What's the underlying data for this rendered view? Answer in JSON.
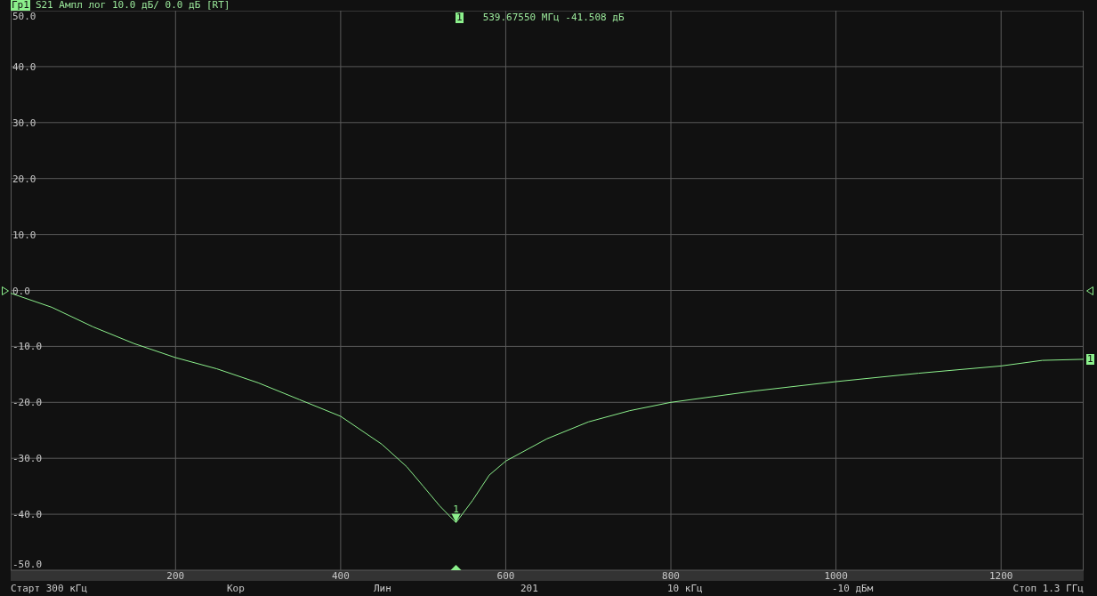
{
  "header": {
    "trace_badge": "Гр1",
    "trace_info": "S21 Ампл лог 10.0 дБ/ 0.0 дБ [RT]"
  },
  "marker_readout": {
    "badge": "1",
    "value": "539.67550 МГц -41.508 дБ"
  },
  "trace_end_badge": "1",
  "chart": {
    "chart_data": {
      "type": "line",
      "grid": true,
      "xlim": [
        0.3,
        1300
      ],
      "ylim": [
        -50,
        50
      ],
      "xticks": [
        {
          "value": 200,
          "label": "200"
        },
        {
          "value": 400,
          "label": "400"
        },
        {
          "value": 600,
          "label": "600"
        },
        {
          "value": 800,
          "label": "800"
        },
        {
          "value": 1000,
          "label": "1000"
        },
        {
          "value": 1200,
          "label": "1200"
        }
      ],
      "yticks": [
        {
          "value": 50,
          "label": "50.0"
        },
        {
          "value": 40,
          "label": "40.0"
        },
        {
          "value": 30,
          "label": "30.0"
        },
        {
          "value": 20,
          "label": "20.0"
        },
        {
          "value": 10,
          "label": "10.0"
        },
        {
          "value": 0,
          "label": "0.0"
        },
        {
          "value": -10,
          "label": "-10.0"
        },
        {
          "value": -20,
          "label": "-20.0"
        },
        {
          "value": -30,
          "label": "-30.0"
        },
        {
          "value": -40,
          "label": "-40.0"
        },
        {
          "value": -50,
          "label": "-50.0"
        }
      ],
      "x": [
        0.3,
        50,
        100,
        150,
        200,
        250,
        300,
        350,
        400,
        450,
        480,
        500,
        520,
        539.7,
        560,
        580,
        600,
        650,
        700,
        750,
        800,
        900,
        1000,
        1100,
        1200,
        1250,
        1300
      ],
      "series": [
        {
          "color": "#8cf08c",
          "values": [
            -0.5,
            -3,
            -6.5,
            -9.5,
            -12,
            -14,
            -16.5,
            -19.5,
            -22.5,
            -27.5,
            -31.5,
            -35,
            -38.5,
            -41.5,
            -37.5,
            -33,
            -30.5,
            -26.5,
            -23.5,
            -21.5,
            -20,
            -18,
            -16.3,
            -14.8,
            -13.5,
            -12.5,
            -12.3
          ]
        }
      ],
      "annotations": [
        {
          "x": 539.7,
          "y": -41.5,
          "text": "1"
        }
      ]
    }
  },
  "status_bar": [
    "Старт 300 кГц",
    "Кор",
    "Лин",
    "201",
    "10 кГц",
    "-10 дБм",
    "Стоп 1.3 ГГц"
  ]
}
